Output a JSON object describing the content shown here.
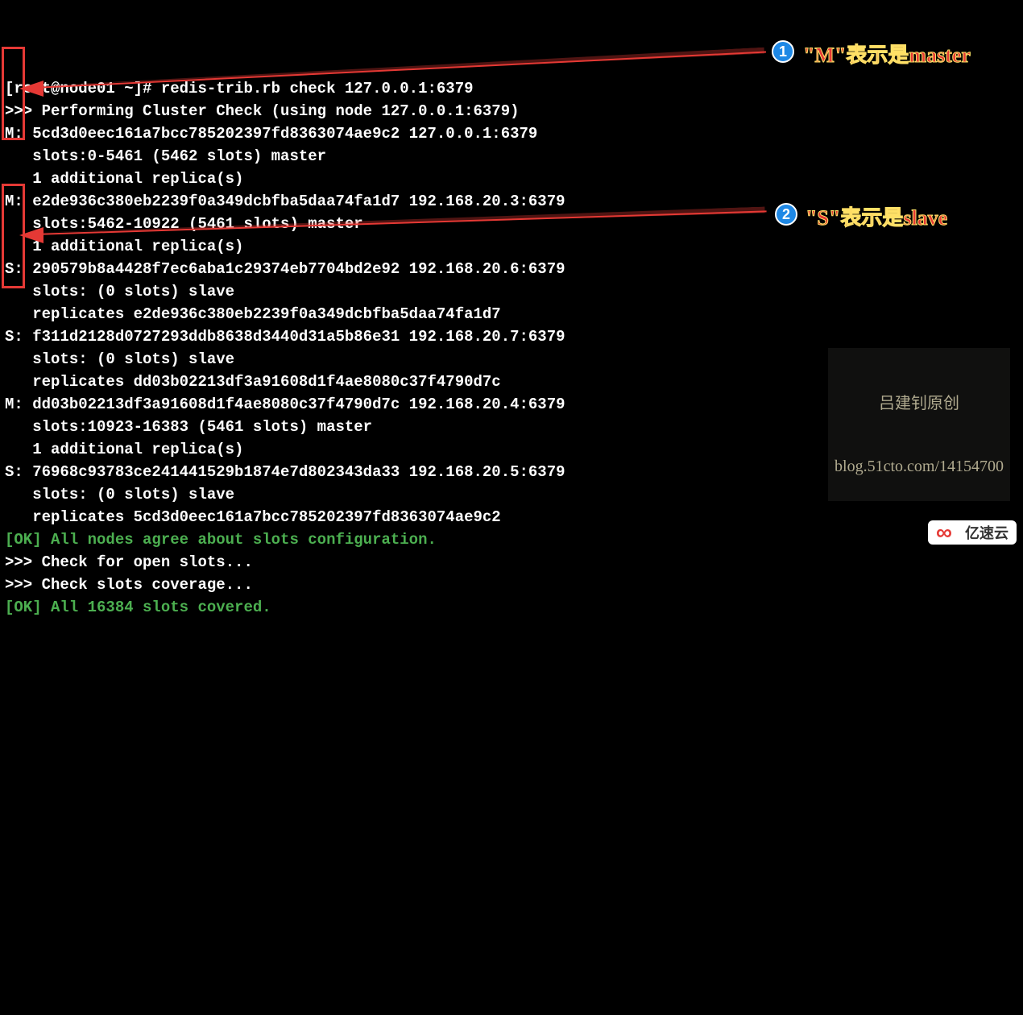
{
  "terminal": {
    "lines": [
      {
        "cls": "",
        "text": "[root@node01 ~]# redis-trib.rb check 127.0.0.1:6379"
      },
      {
        "cls": "",
        "text": ">>> Performing Cluster Check (using node 127.0.0.1:6379)"
      },
      {
        "cls": "",
        "text": "M: 5cd3d0eec161a7bcc785202397fd8363074ae9c2 127.0.0.1:6379"
      },
      {
        "cls": "",
        "text": "   slots:0-5461 (5462 slots) master"
      },
      {
        "cls": "",
        "text": "   1 additional replica(s)"
      },
      {
        "cls": "",
        "text": "M: e2de936c380eb2239f0a349dcbfba5daa74fa1d7 192.168.20.3:6379"
      },
      {
        "cls": "",
        "text": "   slots:5462-10922 (5461 slots) master"
      },
      {
        "cls": "",
        "text": "   1 additional replica(s)"
      },
      {
        "cls": "",
        "text": "S: 290579b8a4428f7ec6aba1c29374eb7704bd2e92 192.168.20.6:6379"
      },
      {
        "cls": "",
        "text": "   slots: (0 slots) slave"
      },
      {
        "cls": "",
        "text": "   replicates e2de936c380eb2239f0a349dcbfba5daa74fa1d7"
      },
      {
        "cls": "",
        "text": "S: f311d2128d0727293ddb8638d3440d31a5b86e31 192.168.20.7:6379"
      },
      {
        "cls": "",
        "text": "   slots: (0 slots) slave"
      },
      {
        "cls": "",
        "text": "   replicates dd03b02213df3a91608d1f4ae8080c37f4790d7c"
      },
      {
        "cls": "",
        "text": "M: dd03b02213df3a91608d1f4ae8080c37f4790d7c 192.168.20.4:6379"
      },
      {
        "cls": "",
        "text": "   slots:10923-16383 (5461 slots) master"
      },
      {
        "cls": "",
        "text": "   1 additional replica(s)"
      },
      {
        "cls": "",
        "text": "S: 76968c93783ce241441529b1874e7d802343da33 192.168.20.5:6379"
      },
      {
        "cls": "",
        "text": "   slots: (0 slots) slave"
      },
      {
        "cls": "",
        "text": "   replicates 5cd3d0eec161a7bcc785202397fd8363074ae9c2"
      },
      {
        "cls": "ok-text",
        "text": "[OK] All nodes agree about slots configuration."
      },
      {
        "cls": "",
        "text": ">>> Check for open slots..."
      },
      {
        "cls": "",
        "text": ">>> Check slots coverage..."
      },
      {
        "cls": "ok-text",
        "text": "[OK] All 16384 slots covered."
      }
    ]
  },
  "annotations": {
    "badge1": "1",
    "anno1": "\"M\"表示是master",
    "badge2": "2",
    "anno2": "\"S\"表示是slave"
  },
  "watermark": {
    "line1": "吕建钊原创",
    "line2": "blog.51cto.com/14154700",
    "brand": "亿速云"
  }
}
